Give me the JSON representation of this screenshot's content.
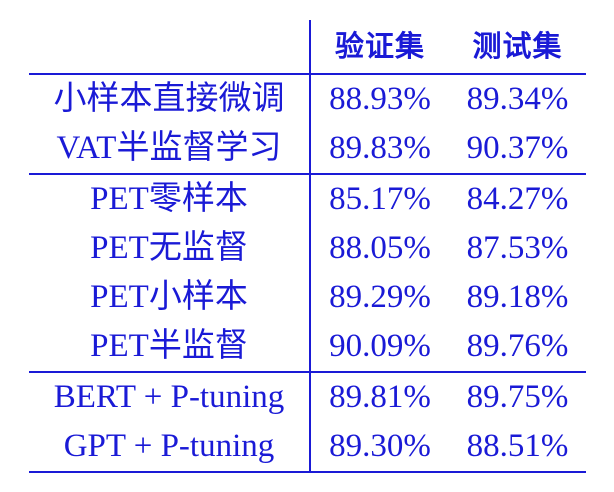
{
  "table": {
    "headers": [
      "",
      "验证集",
      "测试集"
    ],
    "groups": [
      {
        "rows": [
          {
            "method": "小样本直接微调",
            "val": "88.93%",
            "test": "89.34%"
          },
          {
            "method": "VAT半监督学习",
            "val": "89.83%",
            "test": "90.37%"
          }
        ]
      },
      {
        "rows": [
          {
            "method": "PET零样本",
            "val": "85.17%",
            "test": "84.27%"
          },
          {
            "method": "PET无监督",
            "val": "88.05%",
            "test": "87.53%"
          },
          {
            "method": "PET小样本",
            "val": "89.29%",
            "test": "89.18%"
          },
          {
            "method": "PET半监督",
            "val": "90.09%",
            "test": "89.76%"
          }
        ]
      },
      {
        "rows": [
          {
            "method": "BERT + P-tuning",
            "val": "89.81%",
            "test": "89.75%"
          },
          {
            "method": "GPT + P-tuning",
            "val": "89.30%",
            "test": "88.51%"
          }
        ]
      }
    ],
    "color": "#1a1ad6"
  }
}
